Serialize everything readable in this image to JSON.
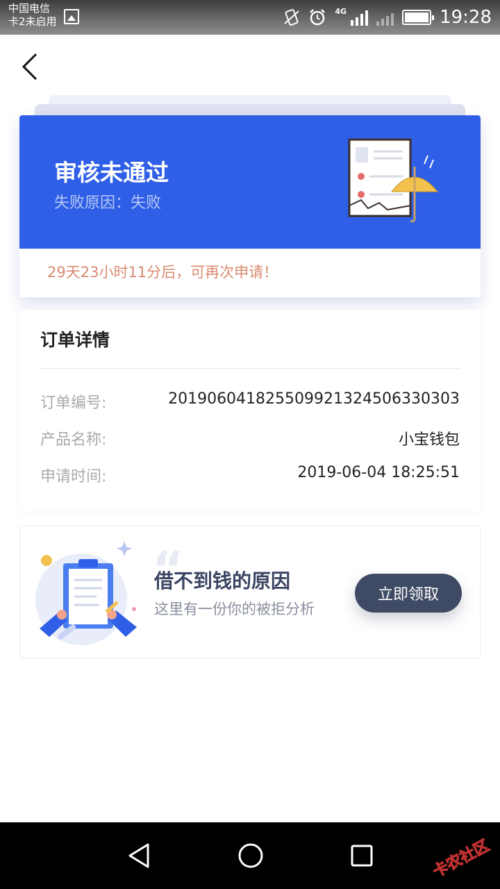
{
  "status_bar": {
    "carrier_line1": "中国电信",
    "carrier_line2": "卡2未启用",
    "network": "4G",
    "time": "19:28"
  },
  "status_card": {
    "title": "审核未通过",
    "reason": "失败原因：失败",
    "retry_notice": "29天23小时11分后，可再次申请！",
    "colors": {
      "banner": "#2f5fe6",
      "notice": "#d98a70"
    }
  },
  "order_details": {
    "title": "订单详情",
    "rows": [
      {
        "label": "订单编号:",
        "value": "201906041825509921324506330303"
      },
      {
        "label": "产品名称:",
        "value": "小宝钱包"
      },
      {
        "label": "申请时间:",
        "value": "2019-06-04 18:25:51"
      }
    ]
  },
  "promo": {
    "quote_mark": "“",
    "title": "借不到钱的原因",
    "subtitle": "这里有一份你的被拒分析",
    "button_label": "立即领取",
    "colors": {
      "button": "#3f4a64"
    }
  },
  "watermark": {
    "text": "卡农社区"
  }
}
